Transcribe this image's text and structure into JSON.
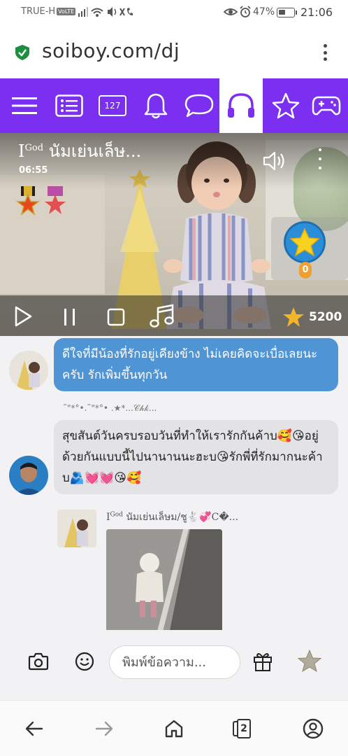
{
  "status_bar": {
    "carrier": "TRUE-H",
    "volte": "VoLTE",
    "battery": "47%",
    "battery_level": 0.47,
    "time": "21:06"
  },
  "browser": {
    "url": "soiboy.com/dj",
    "secure_icon": "shield-check-icon",
    "menu_icon": "kebab-menu-icon",
    "bottom_nav": {
      "back_icon": "arrow-left-icon",
      "forward_icon": "arrow-right-icon",
      "home_icon": "home-icon",
      "tabs_count": "2",
      "account_icon": "account-icon"
    }
  },
  "top_nav": {
    "accent_color": "#7b2ff0",
    "items": [
      {
        "icon": "hamburger-menu-icon"
      },
      {
        "icon": "list-icon"
      },
      {
        "icon": "counter-badge-icon",
        "label": "127"
      },
      {
        "icon": "bell-icon"
      },
      {
        "icon": "chat-bubble-icon"
      },
      {
        "icon": "headphones-icon",
        "active": true
      },
      {
        "icon": "star-outline-icon"
      },
      {
        "icon": "gamepad-icon"
      }
    ]
  },
  "player": {
    "title_prefix": "I",
    "title_sup": "God",
    "title": "นัมเย่นเล็ษ...",
    "time": "06:55",
    "volume_icon": "volume-icon",
    "star_badge_count": "0",
    "score": "5200",
    "controls": [
      {
        "icon": "play-icon"
      },
      {
        "icon": "pause-icon"
      },
      {
        "icon": "stop-icon"
      },
      {
        "icon": "music-note-icon"
      }
    ]
  },
  "messages": [
    {
      "side": "left",
      "style": "blue",
      "text": "ดีใจที่มีน้องที่รักอยู่เคียงข้าง ไม่เคยคิดจะเบื่อเลยนะครับ รักเพิ่มขึ้นทุกวัน"
    },
    {
      "sender": "˜\"*°•.˜\"*°• .★*...𝒞𝒽𝓀...",
      "side": "left",
      "style": "grey",
      "text": "สุขสันต์วันครบรอบวันที่ทำให้เรารักกันค้าบ🥰😘อยู่ด้วยกันแบบนี้ไปนานานนะฮะบ😘รักพี่ที่รักมากนะค้าบ🫂💓💓😘🥰"
    },
    {
      "sender_prefix": "I",
      "sender_sup": "God",
      "sender": "นัมเย่นเล็ษม/ชู🐇💞C�...",
      "side": "left",
      "style": "image"
    }
  ],
  "input_bar": {
    "placeholder": "พิมพ์ข้อความ...",
    "camera_icon": "camera-icon",
    "emoji_icon": "smiley-icon",
    "gift_icon": "gift-icon",
    "star_icon": "star-icon"
  }
}
